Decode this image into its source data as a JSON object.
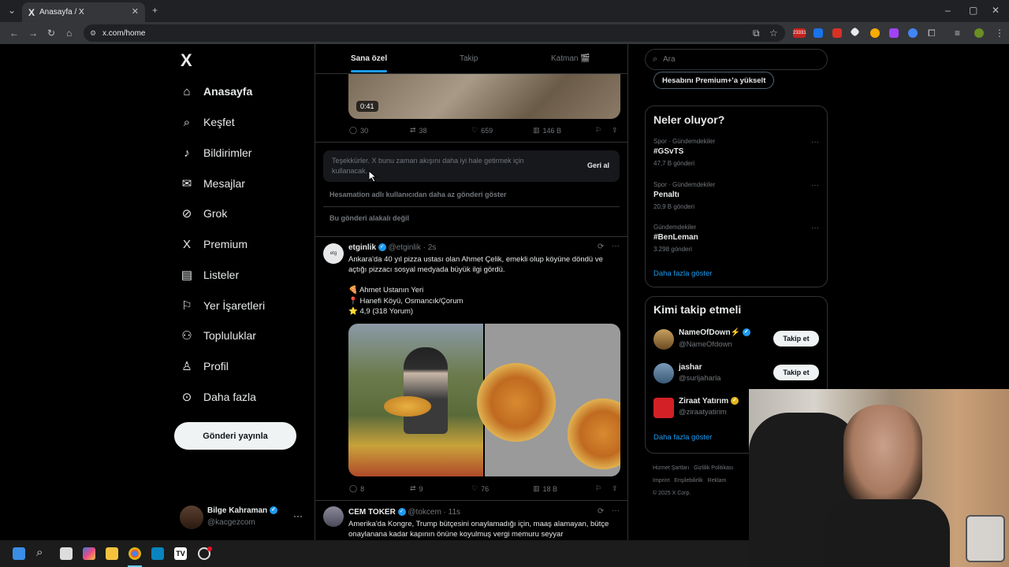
{
  "browser": {
    "tab_title": "Anasayfa / X",
    "url": "x.com/home",
    "ext_badge": "23331"
  },
  "nav": {
    "logo": "X",
    "items": [
      {
        "label": "Anasayfa",
        "icon": "home-icon",
        "glyph": "⌂"
      },
      {
        "label": "Keşfet",
        "icon": "search-icon",
        "glyph": "⌕"
      },
      {
        "label": "Bildirimler",
        "icon": "bell-icon",
        "glyph": "♪"
      },
      {
        "label": "Mesajlar",
        "icon": "mail-icon",
        "glyph": "✉"
      },
      {
        "label": "Grok",
        "icon": "grok-icon",
        "glyph": "⊘"
      },
      {
        "label": "Premium",
        "icon": "x-premium-icon",
        "glyph": "X"
      },
      {
        "label": "Listeler",
        "icon": "list-icon",
        "glyph": "▤"
      },
      {
        "label": "Yer İşaretleri",
        "icon": "bookmark-icon",
        "glyph": "⚐"
      },
      {
        "label": "Topluluklar",
        "icon": "communities-icon",
        "glyph": "⚇"
      },
      {
        "label": "Profil",
        "icon": "profile-icon",
        "glyph": "♙"
      },
      {
        "label": "Daha fazla",
        "icon": "more-icon",
        "glyph": "⊙"
      }
    ],
    "post_button": "Gönderi yayınla",
    "account": {
      "name": "Bilge Kahraman",
      "handle": "@kacgezcom",
      "more": "···"
    }
  },
  "feed": {
    "tabs": [
      "Sana özel",
      "Takip",
      "Katman 🎬"
    ],
    "video": {
      "duration": "0:41"
    },
    "post1_metrics": {
      "replies": "30",
      "reposts": "38",
      "likes": "659",
      "views": "146 B"
    },
    "feedback": {
      "text": "Teşekkürler. X bunu zaman akışını daha iyi hale getirmek için kullanacak.",
      "undo": "Geri al",
      "option1": "Hesamation adlı kullanıcıdan daha az gönderi göster",
      "option2": "Bu gönderi alakalı değil"
    },
    "post2": {
      "name": "etginlik",
      "handle": "@etginlik · 2s",
      "text": "Ankara'da 40 yıl pizza ustası olan Ahmet Çelik, emekli olup köyüne döndü ve açtığı pizzacı sosyal medyada büyük ilgi gördü.",
      "line1": "🍕 Ahmet Ustanın Yeri",
      "line2": "📍 Hanefi Köyü, Osmancık/Çorum",
      "line3": "⭐ 4,9 (318 Yorum)",
      "metrics": {
        "replies": "8",
        "reposts": "9",
        "likes": "76",
        "views": "18 B"
      }
    },
    "post3": {
      "name": "CEM TOKER",
      "handle": "@tokcem · 11s",
      "text": "Amerika'da Kongre, Trump bütçesini onaylamadığı için, maaş alamayan, bütçe onaylanana kadar kapının önüne koyulmuş vergi memuru seyyar"
    }
  },
  "right": {
    "search_placeholder": "Ara",
    "premium_button": "Hesabını Premium+'a yükselt",
    "trends_title": "Neler oluyor?",
    "trends": [
      {
        "meta": "Spor · Gündemdekiler",
        "name": "#GSvTS",
        "count": "47,7 B gönderi"
      },
      {
        "meta": "Spor · Gündemdekiler",
        "name": "Penaltı",
        "count": "20,9 B gönderi"
      },
      {
        "meta": "Gündemdekiler",
        "name": "#BenLeman",
        "count": "3.298 gönderi"
      }
    ],
    "show_more": "Daha fazla göster",
    "who_title": "Kimi takip etmeli",
    "who": [
      {
        "name": "NameOfDown⚡",
        "handle": "@NameOfdown",
        "button": "Takip et"
      },
      {
        "name": "jashar",
        "handle": "@surljaharla",
        "button": "Takip et"
      },
      {
        "name": "Ziraat Yatırım",
        "handle": "@ziraatyatirim",
        "button": ""
      }
    ],
    "who_more": "Daha fazla göster",
    "footer": [
      "Hizmet Şartları",
      "Gizlilik Politikası",
      "Imprint",
      "Erişilebilirlik",
      "Reklam",
      "© 2025 X Corp."
    ]
  },
  "colors": {
    "accent": "#1d9bf0",
    "bg": "#000000",
    "border": "#2f3336",
    "muted": "#71767b"
  }
}
